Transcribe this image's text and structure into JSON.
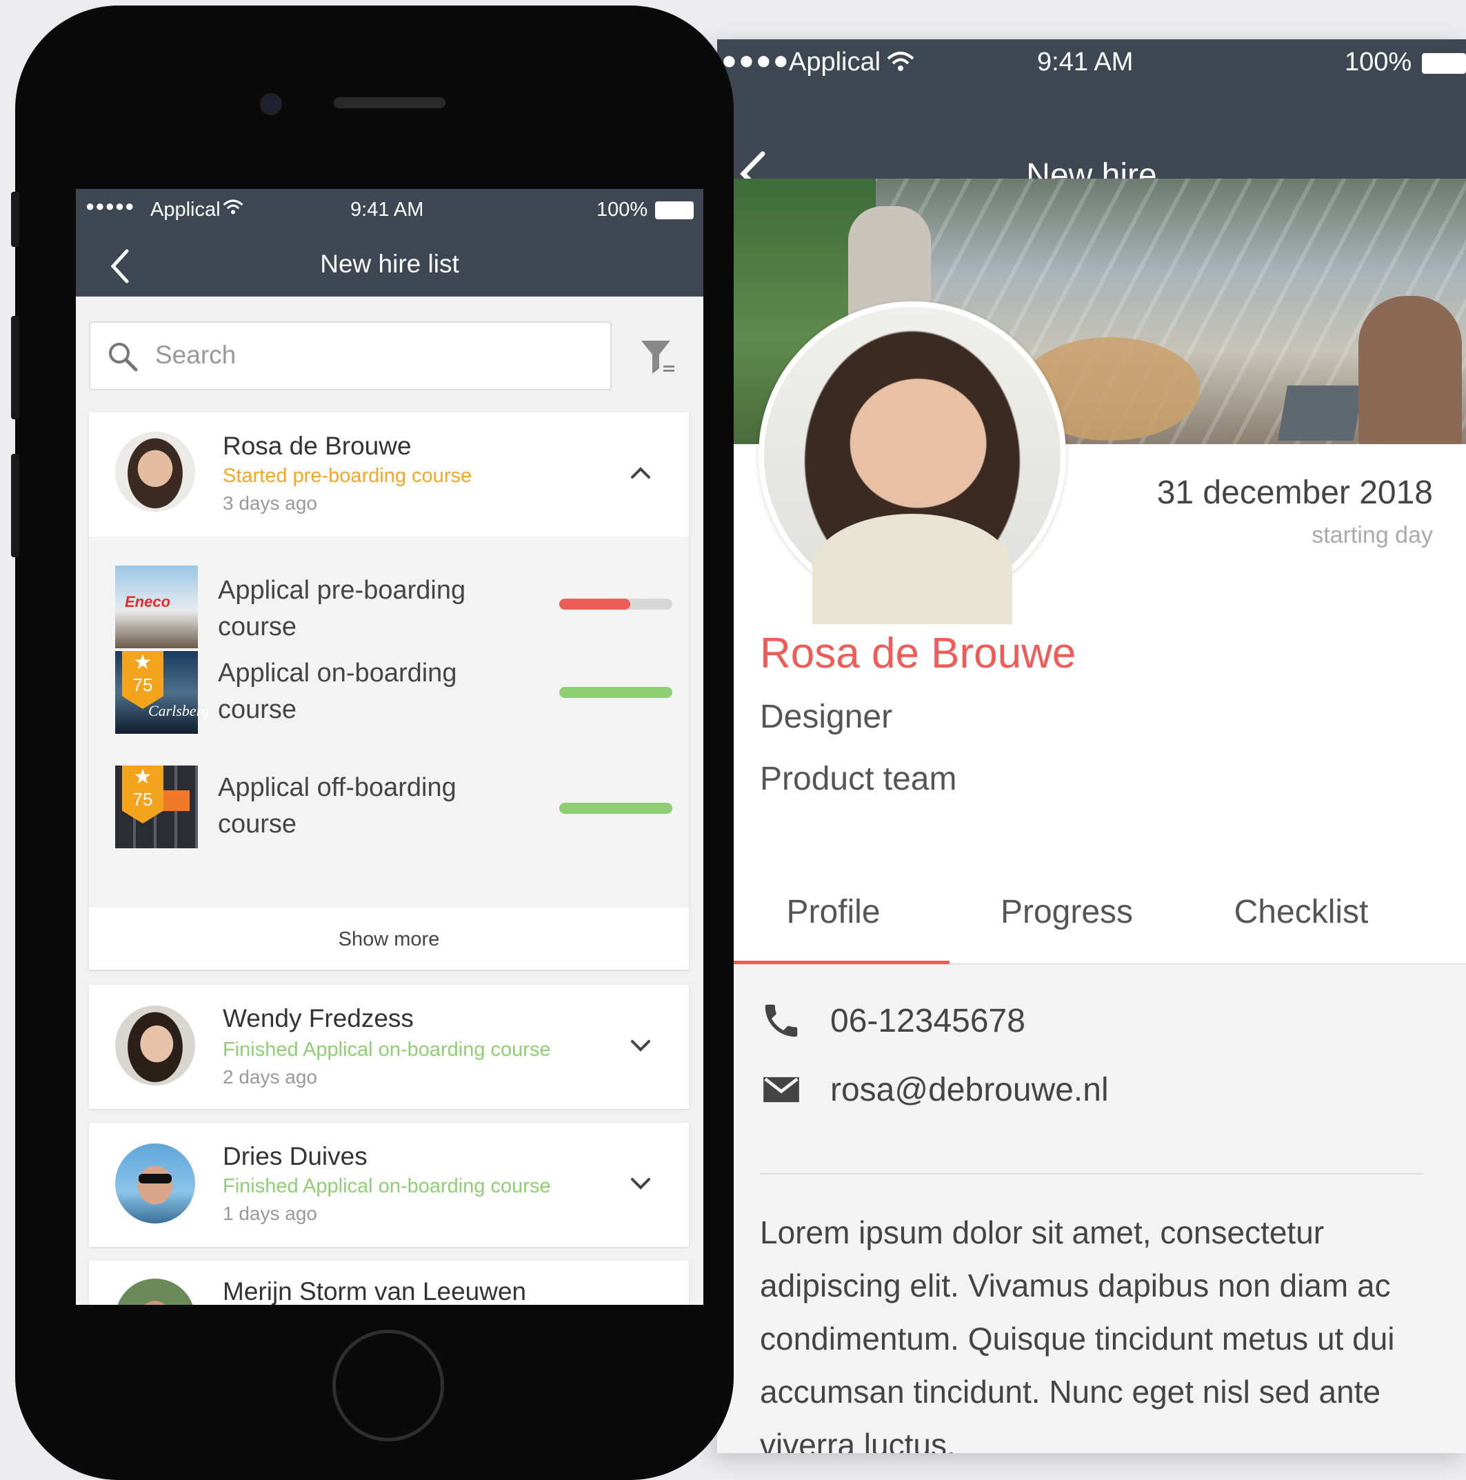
{
  "colors": {
    "header_bg": "#3f4753",
    "accent_red": "#ef5b57",
    "status_orange": "#f5a623",
    "status_green": "#8fcf74",
    "progress_track": "#d6d6d6"
  },
  "detail_screen": {
    "status_bar": {
      "carrier": "Applical",
      "time": "9:41 AM",
      "battery": "100%"
    },
    "nav": {
      "title": "New hire",
      "back_icon": "chevron-left-icon"
    },
    "start_date": {
      "value": "31 december 2018",
      "label": "starting day"
    },
    "person": {
      "name": "Rosa de Brouwe",
      "role": "Designer",
      "team": "Product team"
    },
    "tabs": [
      {
        "label": "Profile",
        "active": true
      },
      {
        "label": "Progress",
        "active": false
      },
      {
        "label": "Checklist",
        "active": false
      }
    ],
    "contact": {
      "phone": {
        "icon": "phone-icon",
        "value": "06-12345678"
      },
      "email": {
        "icon": "mail-icon",
        "value": "rosa@debrouwe.nl"
      }
    },
    "bio": "Lorem ipsum dolor sit amet, consectetur adipiscing elit. Vivamus dapibus non diam ac condimentum. Quisque tincidunt metus ut dui accumsan tincidunt. Nunc eget nisl sed ante viverra luctus."
  },
  "list_screen": {
    "status_bar": {
      "carrier": "Applical",
      "time": "9:41 AM",
      "battery": "100%"
    },
    "nav": {
      "title": "New hire list",
      "back_icon": "chevron-left-icon"
    },
    "search": {
      "placeholder": "Search",
      "icon": "search-icon",
      "filter_icon": "filter-icon"
    },
    "hires": [
      {
        "name": "Rosa de Brouwe",
        "status": "Started pre-boarding course",
        "status_type": "started",
        "time": "3 days ago",
        "expanded": true,
        "courses": [
          {
            "name": "Applical pre-boarding course",
            "thumb_text": "Eneco",
            "progress": 0.63,
            "badge": null
          },
          {
            "name": "Applical on-boarding course",
            "thumb_text": "Carlsberg",
            "progress": 1.0,
            "badge": "75"
          },
          {
            "name": "Applical off-boarding course",
            "thumb_text": "",
            "progress": 1.0,
            "badge": "75"
          }
        ],
        "show_more": "Show more"
      },
      {
        "name": "Wendy Fredzess",
        "status": "Finished Applical on-boarding course",
        "status_type": "finished",
        "time": "2 days ago",
        "expanded": false
      },
      {
        "name": "Dries Duives",
        "status": "Finished Applical on-boarding course",
        "status_type": "finished",
        "time": "1 days ago",
        "expanded": false
      },
      {
        "name": "Merijn Storm van Leeuwen",
        "expanded": false
      }
    ]
  }
}
